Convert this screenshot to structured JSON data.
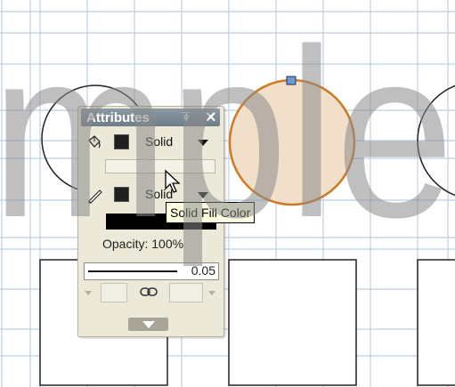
{
  "panel": {
    "title": "Attributes",
    "fill": {
      "style_label": "Solid",
      "icon": "paint-bucket-icon",
      "color": "#202020"
    },
    "stroke": {
      "style_label": "Solid",
      "icon": "pencil-icon",
      "color": "#202020"
    },
    "opacity_label": "Opacity: 100%",
    "stroke_width_value": "0.05",
    "link_icon": "link-icon"
  },
  "tooltip": {
    "text": "Solid Fill Color"
  },
  "watermark": {
    "text": "mple"
  },
  "colors": {
    "grid": "#bcd0e4",
    "selected_fill": "#f2dfca",
    "selected_stroke": "#cc7a24",
    "handle": "#6a9bd6"
  }
}
